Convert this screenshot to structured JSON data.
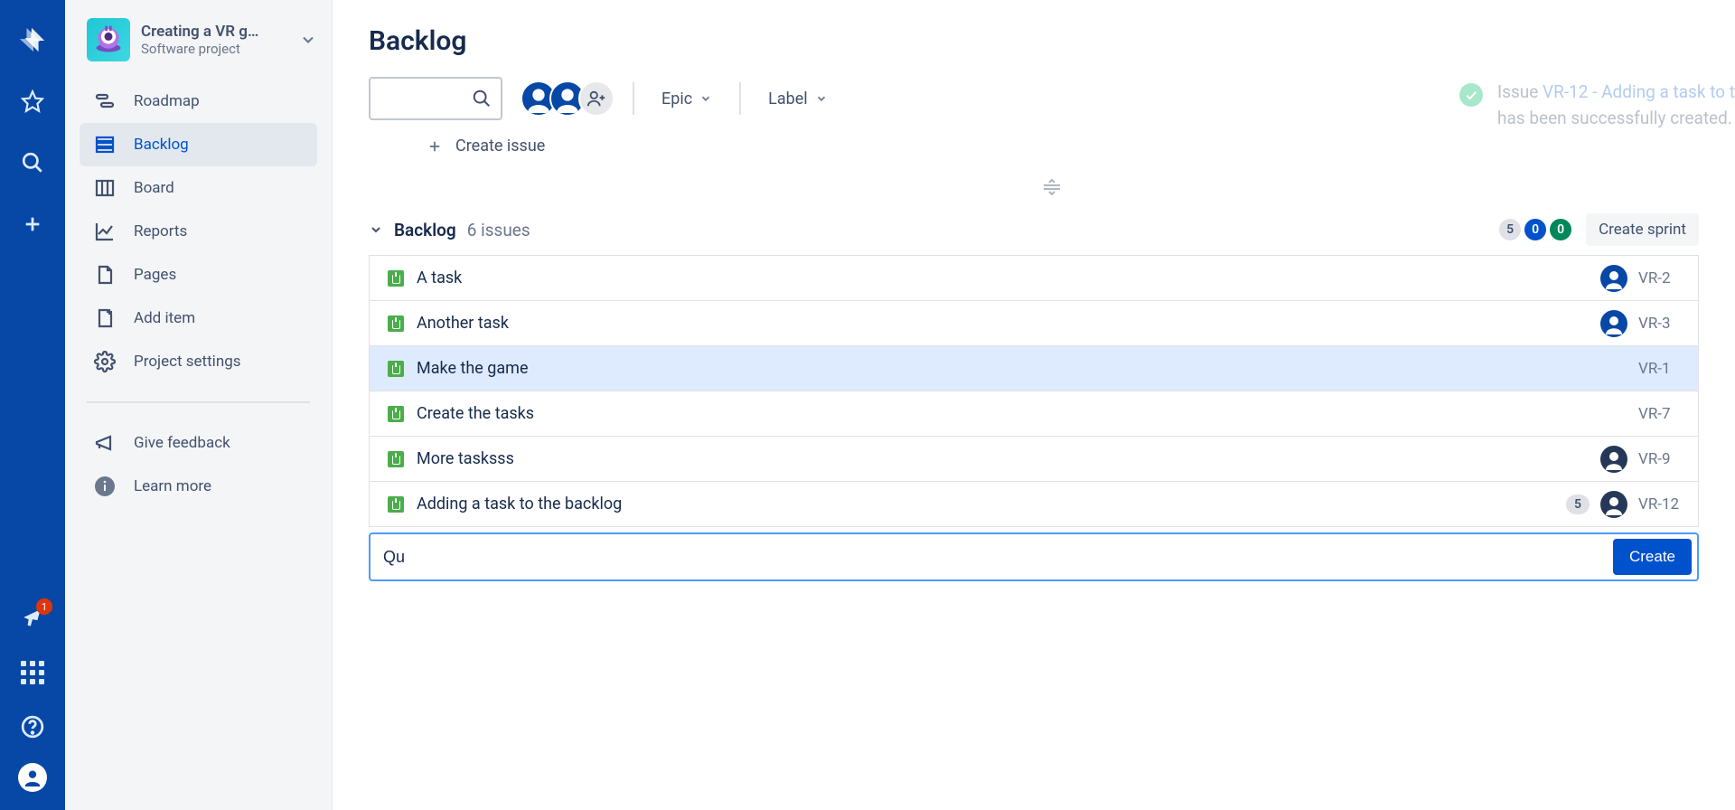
{
  "globalNav": {
    "notificationBadge": "1"
  },
  "project": {
    "name": "Creating a VR g…",
    "type": "Software project"
  },
  "sidebar": {
    "items": [
      {
        "label": "Roadmap"
      },
      {
        "label": "Backlog"
      },
      {
        "label": "Board"
      },
      {
        "label": "Reports"
      },
      {
        "label": "Pages"
      },
      {
        "label": "Add item"
      },
      {
        "label": "Project settings"
      }
    ],
    "footer": [
      {
        "label": "Give feedback"
      },
      {
        "label": "Learn more"
      }
    ]
  },
  "page": {
    "title": "Backlog"
  },
  "filters": {
    "epic": "Epic",
    "label": "Label"
  },
  "toast": {
    "prefix": "Issue ",
    "link": "VR-12 - Adding a task to t",
    "line2": "has been successfully created."
  },
  "createIssue": {
    "label": "Create issue"
  },
  "backlogSection": {
    "title": "Backlog",
    "countText": "6 issues",
    "pills": {
      "todo": "5",
      "inprogress": "0",
      "done": "0"
    },
    "createSprint": "Create sprint"
  },
  "issues": [
    {
      "summary": "A task",
      "key": "VR-2",
      "hasAvatar": true,
      "avatarStyle": "blue",
      "estimate": null,
      "selected": false
    },
    {
      "summary": "Another task",
      "key": "VR-3",
      "hasAvatar": true,
      "avatarStyle": "blue",
      "estimate": null,
      "selected": false
    },
    {
      "summary": "Make the game",
      "key": "VR-1",
      "hasAvatar": false,
      "avatarStyle": "",
      "estimate": null,
      "selected": true
    },
    {
      "summary": "Create the tasks",
      "key": "VR-7",
      "hasAvatar": false,
      "avatarStyle": "",
      "estimate": null,
      "selected": false
    },
    {
      "summary": "More tasksss",
      "key": "VR-9",
      "hasAvatar": true,
      "avatarStyle": "dark",
      "estimate": null,
      "selected": false
    },
    {
      "summary": "Adding a task to the backlog",
      "key": "VR-12",
      "hasAvatar": true,
      "avatarStyle": "dark",
      "estimate": "5",
      "selected": false
    }
  ],
  "inlineCreate": {
    "value": "Qu",
    "button": "Create"
  }
}
